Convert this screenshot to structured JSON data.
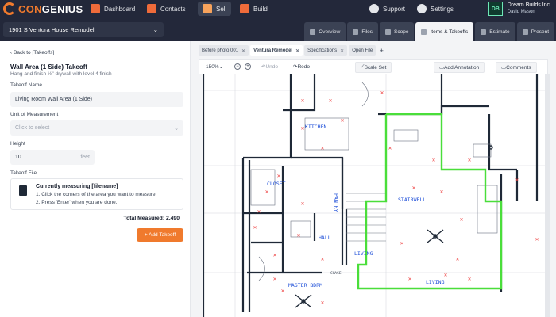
{
  "brand": {
    "part1": "CON",
    "part2": "GENIUS",
    "accent": "#f07a2d"
  },
  "nav": {
    "items": [
      {
        "label": "Dashboard",
        "icon": "dashboard-icon"
      },
      {
        "label": "Contacts",
        "icon": "contacts-icon"
      },
      {
        "label": "Sell",
        "icon": "sell-icon"
      },
      {
        "label": "Build",
        "icon": "build-icon"
      }
    ],
    "support": "Support",
    "settings": "Settings",
    "company": "Dream Builds Inc.",
    "user": "David Mason",
    "logo_text": "DB"
  },
  "project": {
    "name": "1901 S Ventura House Remodel"
  },
  "tabs": [
    "Overview",
    "Files",
    "Scope",
    "Items & Takeoffs",
    "Estimate",
    "Present"
  ],
  "panel": {
    "back": "Back to [Takeoffs]",
    "title": "Wall Area (1 Side) Takeoff",
    "subtitle": "Hang and finish ½\" drywall with level 4 finish",
    "name_label": "Takeoff Name",
    "name_value": "Living Room Wall Area (1 Side)",
    "unit_label": "Unit of Measurement",
    "unit_placeholder": "Click to select",
    "height_label": "Height",
    "height_value": "10",
    "height_unit": "feet",
    "file_label": "Takeoff File",
    "file_title": "Currently measuring [filename]",
    "file_step1": "1. Click the corners of the area you want to measure.",
    "file_step2": "2. Press 'Enter' when you are done.",
    "total": "Total Measured: 2,490",
    "add_button": "+ Add Takeoff"
  },
  "file_tabs": [
    {
      "label": "Before photo 001",
      "active": false
    },
    {
      "label": "Ventura Remodel",
      "active": true
    },
    {
      "label": "Specifications",
      "active": false
    },
    {
      "label": "Open File",
      "active": false
    }
  ],
  "toolbar": {
    "zoom": "150%",
    "undo": "Undo",
    "redo": "Redo",
    "scale": "Scale Set",
    "annotation": "Add Annotation",
    "comments": "Comments"
  },
  "plan_labels": [
    "KITCHEN",
    "CLOSET",
    "PANTRY",
    "STAIRWELL",
    "HALL",
    "LIVING",
    "LIVING",
    "MASTER BDRM",
    "CHASE"
  ],
  "colors": {
    "nav_bg": "#23283a",
    "highlight": "#4ade3a",
    "label_blue": "#1d4ed8",
    "marker_red": "#ef4444"
  }
}
